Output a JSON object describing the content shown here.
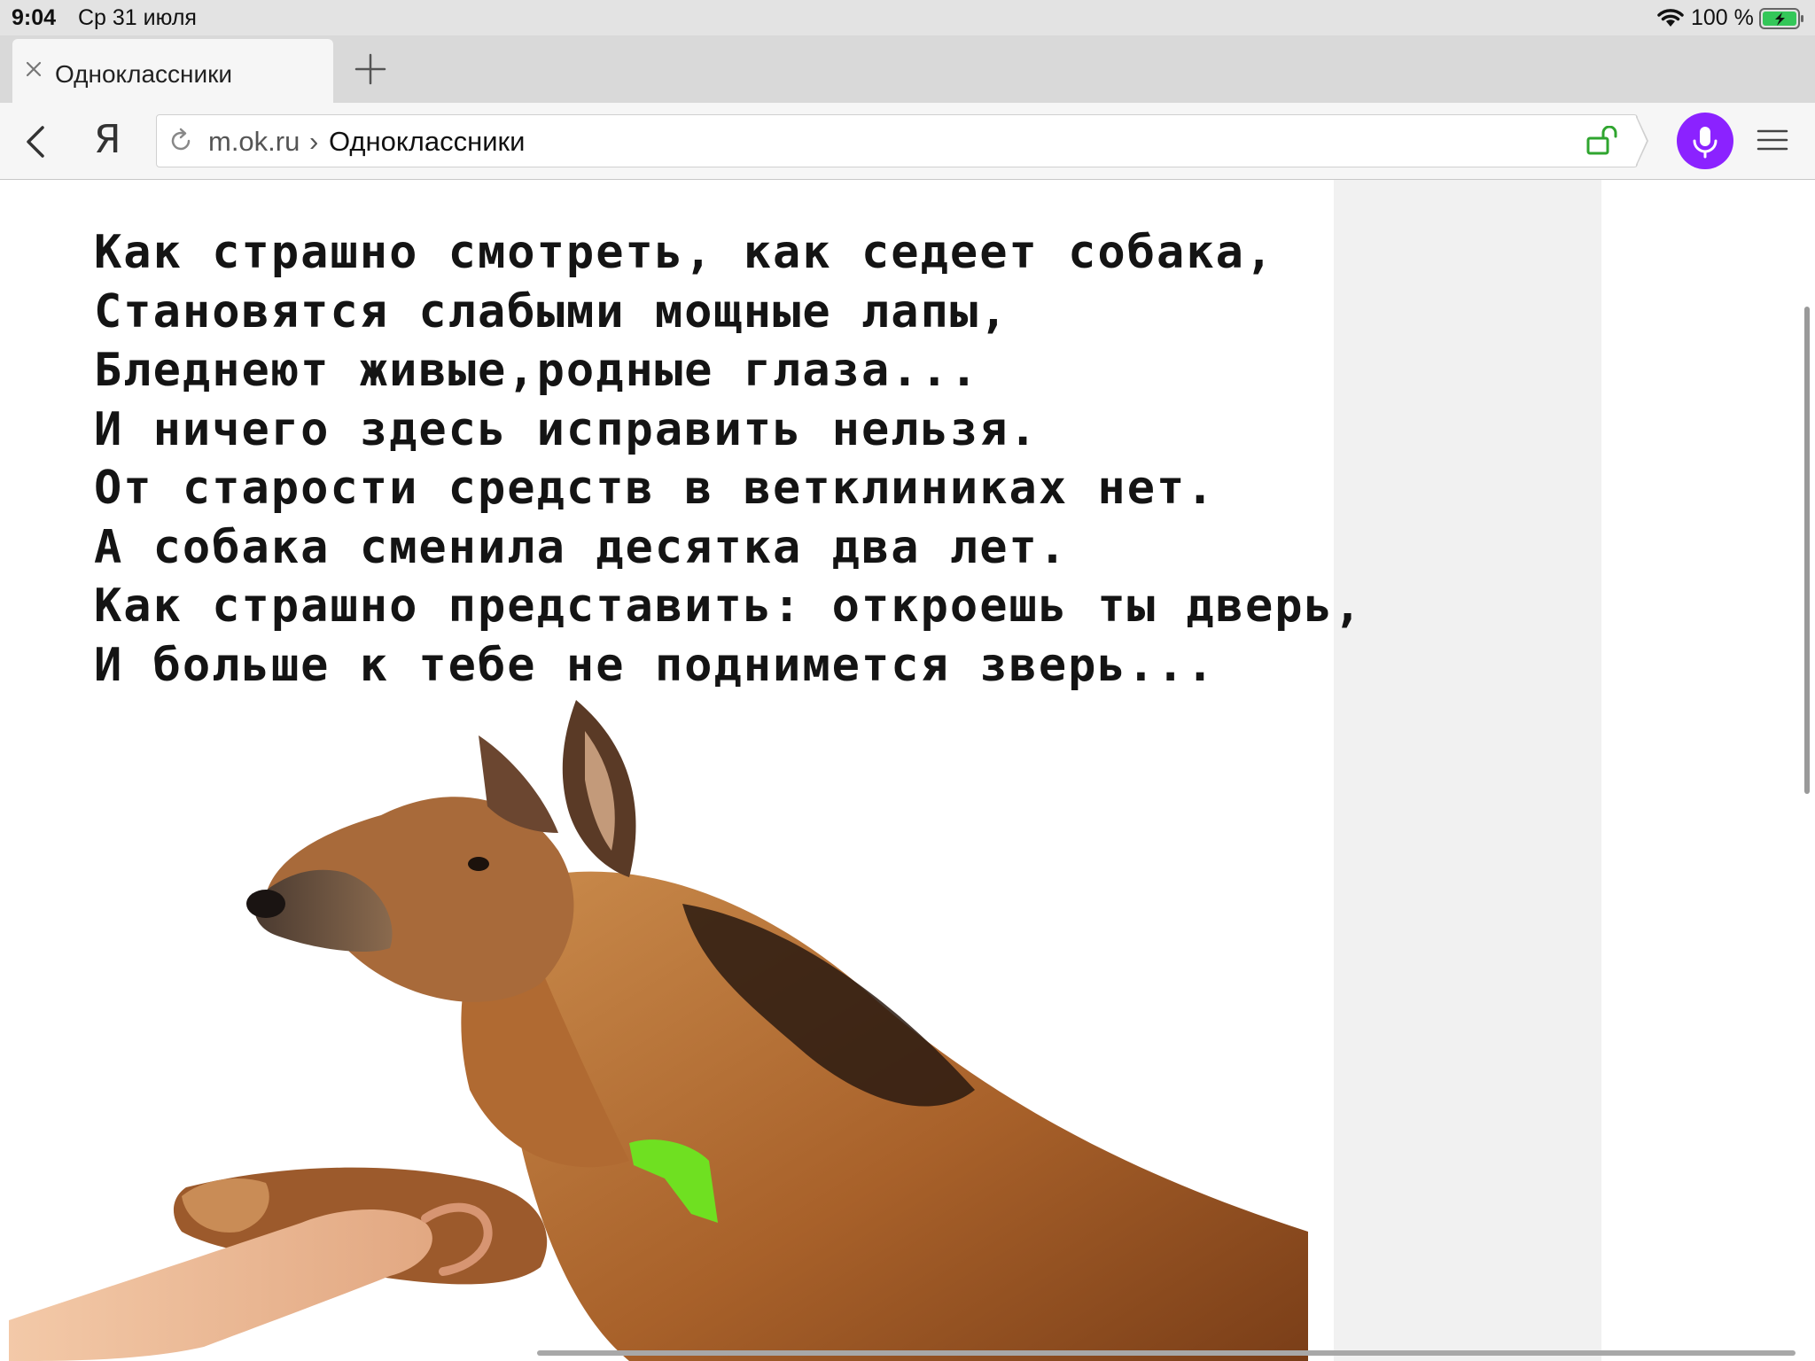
{
  "status": {
    "time": "9:04",
    "date": "Ср 31 июля",
    "battery": "100 %",
    "icons": [
      "wifi-icon",
      "battery-charging-icon"
    ]
  },
  "tabs": [
    {
      "title": "Одноклассники",
      "active": true
    }
  ],
  "toolbar": {
    "yandex_label": "Я",
    "host": "m.ok.ru",
    "separator": "›",
    "page_title": "Одноклассники",
    "icons": [
      "back-icon",
      "reload-icon",
      "unlock-icon",
      "alice-mic-icon",
      "menu-icon"
    ],
    "accent_color": "#8b22ff"
  },
  "poem": {
    "lines": [
      "Как страшно смотреть, как седеет собака,",
      "Становятся слабыми мощные лапы,",
      "Бледнеют живые,родные глаза...",
      "И ничего здесь исправить нельзя.",
      "От старости средств в ветклиниках нет.",
      "А собака сменила десятка два лет.",
      "Как страшно представить: откроешь ты дверь,",
      "И больше к тебе не поднимется зверь..."
    ]
  },
  "image": {
    "subject": "german-shepherd-paw-in-hand"
  }
}
